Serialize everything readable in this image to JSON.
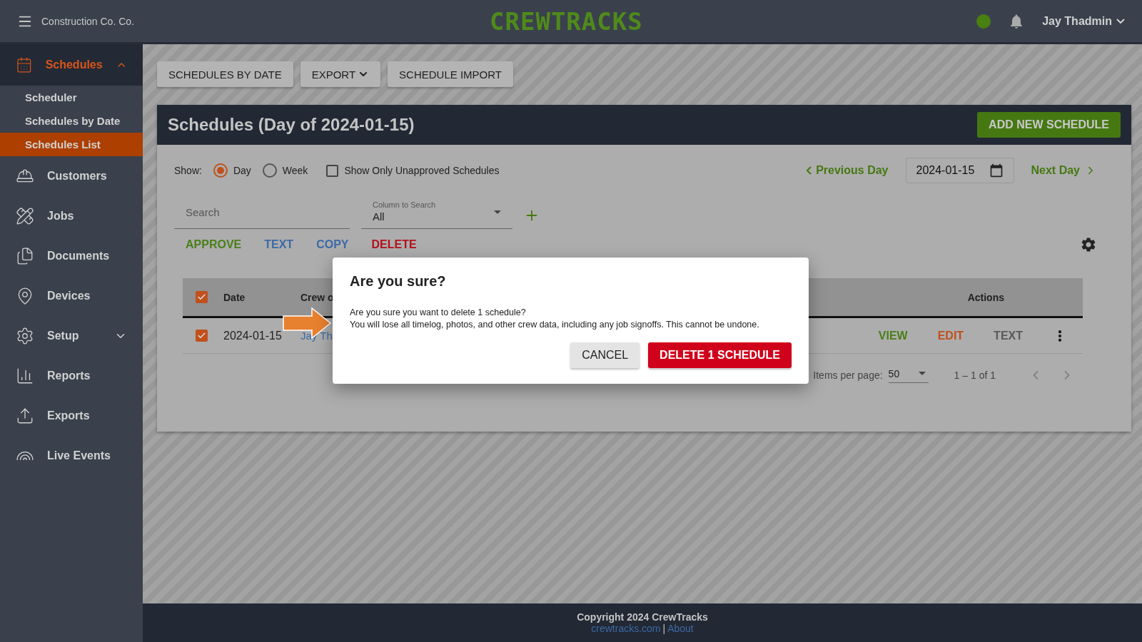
{
  "header": {
    "company": "Construction Co. Co.",
    "logo": "CREWTRACKS",
    "user": "Jay Thadmin"
  },
  "sidebar": {
    "items": [
      {
        "label": "Schedules",
        "kind": "calendar",
        "selected": true,
        "expanded": true,
        "children": [
          {
            "label": "Scheduler",
            "selected": false
          },
          {
            "label": "Schedules by Date",
            "selected": false
          },
          {
            "label": "Schedules List",
            "selected": true
          }
        ]
      },
      {
        "label": "Customers",
        "kind": "worker",
        "selected": false
      },
      {
        "label": "Jobs",
        "kind": "tools",
        "selected": false
      },
      {
        "label": "Documents",
        "kind": "documents",
        "selected": false
      },
      {
        "label": "Devices",
        "kind": "pin",
        "selected": false
      },
      {
        "label": "Setup",
        "kind": "gear",
        "selected": false,
        "expanded": false
      },
      {
        "label": "Reports",
        "kind": "chart",
        "selected": false
      },
      {
        "label": "Exports",
        "kind": "upload",
        "selected": false
      },
      {
        "label": "Live Events",
        "kind": "signal",
        "selected": false
      }
    ]
  },
  "toolbar": [
    {
      "label": "SCHEDULES BY DATE",
      "kind": "button"
    },
    {
      "label": "EXPORT",
      "kind": "dropdown"
    },
    {
      "label": "SCHEDULE IMPORT",
      "kind": "button"
    }
  ],
  "card": {
    "title": "Schedules (Day of 2024-01-15)",
    "add_button": "ADD NEW SCHEDULE",
    "show_label": "Show:",
    "radios": [
      {
        "label": "Day",
        "selected": true
      },
      {
        "label": "Week",
        "selected": false
      }
    ],
    "unapproved": {
      "label": "Show Only Unapproved Schedules",
      "checked": false
    },
    "date_nav": {
      "previous": "Previous Day",
      "date": "2024-01-15",
      "next": "Next Day"
    },
    "search": {
      "placeholder": "Search"
    },
    "column_select": {
      "label": "Column to Search",
      "value": "All"
    },
    "bulk_actions": [
      {
        "label": "APPROVE",
        "color": "#4a7f1a"
      },
      {
        "label": "TEXT",
        "color": "#3d6aa6"
      },
      {
        "label": "COPY",
        "color": "#3d6aa6"
      },
      {
        "label": "DELETE",
        "color": "#b3101c"
      }
    ],
    "table": {
      "all_checked": true,
      "columns": [
        "Date",
        "Crew o",
        "Actions"
      ],
      "rows": [
        {
          "checked": true,
          "date": "2024-01-15",
          "crew": "Jay Th",
          "actions": [
            {
              "label": "VIEW",
              "color": "#4a7f1a"
            },
            {
              "label": "EDIT",
              "color": "#c0501c"
            },
            {
              "label": "TEXT",
              "color": "#5a5a5a"
            }
          ]
        }
      ]
    },
    "pagination": {
      "label": "Items per page:",
      "per_page": "50",
      "range": "1 – 1 of 1"
    }
  },
  "modal": {
    "title": "Are you sure?",
    "message": [
      "Are you sure you want to delete 1 schedule?",
      "You will lose all timelog, photos, and other crew data, including any job signoffs. This cannot be undone."
    ],
    "cancel": "CANCEL",
    "confirm": "DELETE 1 SCHEDULE"
  },
  "footer": {
    "copyright": "Copyright 2024 CrewTracks",
    "links": [
      "crewtracks.com",
      "About"
    ],
    "separator": "|"
  }
}
